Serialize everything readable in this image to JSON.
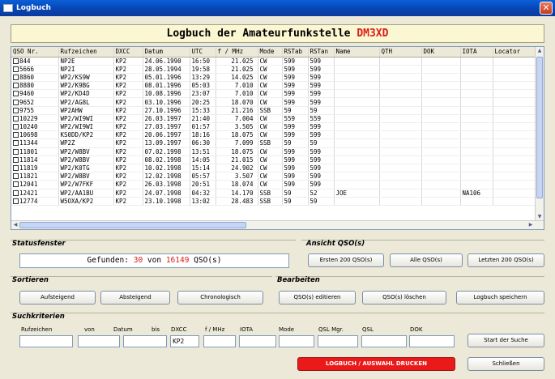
{
  "window": {
    "title": "Logbuch",
    "close": "✕"
  },
  "banner": {
    "prefix": "Logbuch der Amateurfunkstelle ",
    "callsign": "DM3XD"
  },
  "table": {
    "columns": [
      "QSO Nr.",
      "Rufzeichen",
      "DXCC",
      "Datum",
      "UTC",
      "f / MHz",
      "Mode",
      "RSTab",
      "RSTan",
      "Name",
      "QTH",
      "DOK",
      "IOTA",
      "Locator"
    ],
    "rows": [
      [
        "844",
        "NP2E",
        "KP2",
        "24.06.1990",
        "16:50",
        "21.025",
        "CW",
        "599",
        "599",
        "",
        "",
        "",
        "",
        ""
      ],
      [
        "5666",
        "NP2I",
        "KP2",
        "28.05.1994",
        "19:58",
        "21.025",
        "CW",
        "599",
        "599",
        "",
        "",
        "",
        "",
        ""
      ],
      [
        "8860",
        "WP2/KS9W",
        "KP2",
        "05.01.1996",
        "13:29",
        "14.025",
        "CW",
        "599",
        "599",
        "",
        "",
        "",
        "",
        ""
      ],
      [
        "8880",
        "WP2/K9BG",
        "KP2",
        "08.01.1996",
        "05:03",
        "7.010",
        "CW",
        "599",
        "599",
        "",
        "",
        "",
        "",
        ""
      ],
      [
        "9460",
        "WP2/KD4D",
        "KP2",
        "10.08.1996",
        "23:07",
        "7.010",
        "CW",
        "599",
        "599",
        "",
        "",
        "",
        "",
        ""
      ],
      [
        "9652",
        "WP2/AG8L",
        "KP2",
        "03.10.1996",
        "20:25",
        "18.070",
        "CW",
        "599",
        "599",
        "",
        "",
        "",
        "",
        ""
      ],
      [
        "9755",
        "WP2AHW",
        "KP2",
        "27.10.1996",
        "15:33",
        "21.216",
        "SSB",
        "59",
        "59",
        "",
        "",
        "",
        "",
        ""
      ],
      [
        "10229",
        "WP2/WI9WI",
        "KP2",
        "26.03.1997",
        "21:40",
        "7.004",
        "CW",
        "559",
        "559",
        "",
        "",
        "",
        "",
        ""
      ],
      [
        "10240",
        "WP2/WI9WI",
        "KP2",
        "27.03.1997",
        "01:57",
        "3.505",
        "CW",
        "599",
        "599",
        "",
        "",
        "",
        "",
        ""
      ],
      [
        "10698",
        "KS0DD/KP2",
        "KP2",
        "20.06.1997",
        "18:16",
        "18.075",
        "CW",
        "599",
        "599",
        "",
        "",
        "",
        "",
        ""
      ],
      [
        "11344",
        "WP2Z",
        "KP2",
        "13.09.1997",
        "06:30",
        "7.099",
        "SSB",
        "59",
        "59",
        "",
        "",
        "",
        "",
        ""
      ],
      [
        "11801",
        "WP2/W8BV",
        "KP2",
        "07.02.1998",
        "13:51",
        "18.075",
        "CW",
        "599",
        "599",
        "",
        "",
        "",
        "",
        ""
      ],
      [
        "11814",
        "WP2/W8BV",
        "KP2",
        "08.02.1998",
        "14:05",
        "21.015",
        "CW",
        "599",
        "599",
        "",
        "",
        "",
        "",
        ""
      ],
      [
        "11819",
        "WP2/K0TG",
        "KP2",
        "10.02.1998",
        "15:14",
        "24.902",
        "CW",
        "599",
        "599",
        "",
        "",
        "",
        "",
        ""
      ],
      [
        "11821",
        "WP2/W8BV",
        "KP2",
        "12.02.1998",
        "05:57",
        "3.507",
        "CW",
        "599",
        "599",
        "",
        "",
        "",
        "",
        ""
      ],
      [
        "12041",
        "WP2/W7FKF",
        "KP2",
        "26.03.1998",
        "20:51",
        "18.074",
        "CW",
        "599",
        "599",
        "",
        "",
        "",
        "",
        ""
      ],
      [
        "12421",
        "WP2/AA1BU",
        "KP2",
        "24.07.1998",
        "04:32",
        "14.170",
        "SSB",
        "59",
        "52",
        "JOE",
        "",
        "",
        "NA106",
        ""
      ],
      [
        "12774",
        "W5OXA/KP2",
        "KP2",
        "23.10.1998",
        "13:02",
        "28.483",
        "SSB",
        "59",
        "59",
        "",
        "",
        "",
        "",
        ""
      ]
    ]
  },
  "status": {
    "title": "Statusfenster",
    "found_label": "Gefunden:",
    "found_count": "30",
    "of_label": "von",
    "total": "16149",
    "unit": "QSO(s)"
  },
  "view": {
    "title": "Ansicht QSO(s)",
    "first_200": "Ersten 200 QSO(s)",
    "all": "Alle QSO(s)",
    "last_200": "Letzten 200 QSO(s)"
  },
  "sort": {
    "title": "Sortieren",
    "ascending": "Aufsteigend",
    "descending": "Absteigend",
    "chronological": "Chronologisch"
  },
  "edit": {
    "title": "Bearbeiten",
    "edit_qso": "QSO(s) editieren",
    "delete_qso": "QSO(s) löschen",
    "save_log": "Logbuch speichern"
  },
  "search": {
    "title": "Suchkriterien",
    "labels": {
      "call": "Rufzeichen",
      "from": "von",
      "date": "Datum",
      "to": "bis",
      "dxcc": "DXCC",
      "freq": "f / MHz",
      "iota": "IOTA",
      "mode": "Mode",
      "qsl_mgr": "QSL Mgr.",
      "qsl": "QSL",
      "dok": "DOK"
    },
    "values": {
      "dxcc": "KP2"
    },
    "start": "Start der Suche"
  },
  "footer": {
    "print": "LOGBUCH / AUSWAHL DRUCKEN",
    "close": "Schließen"
  },
  "colors": {
    "titlebar": "#0845b4",
    "banner_bg": "#fbf7d2",
    "accent_red": "#d8201a",
    "print_button": "#ea1a1a"
  }
}
